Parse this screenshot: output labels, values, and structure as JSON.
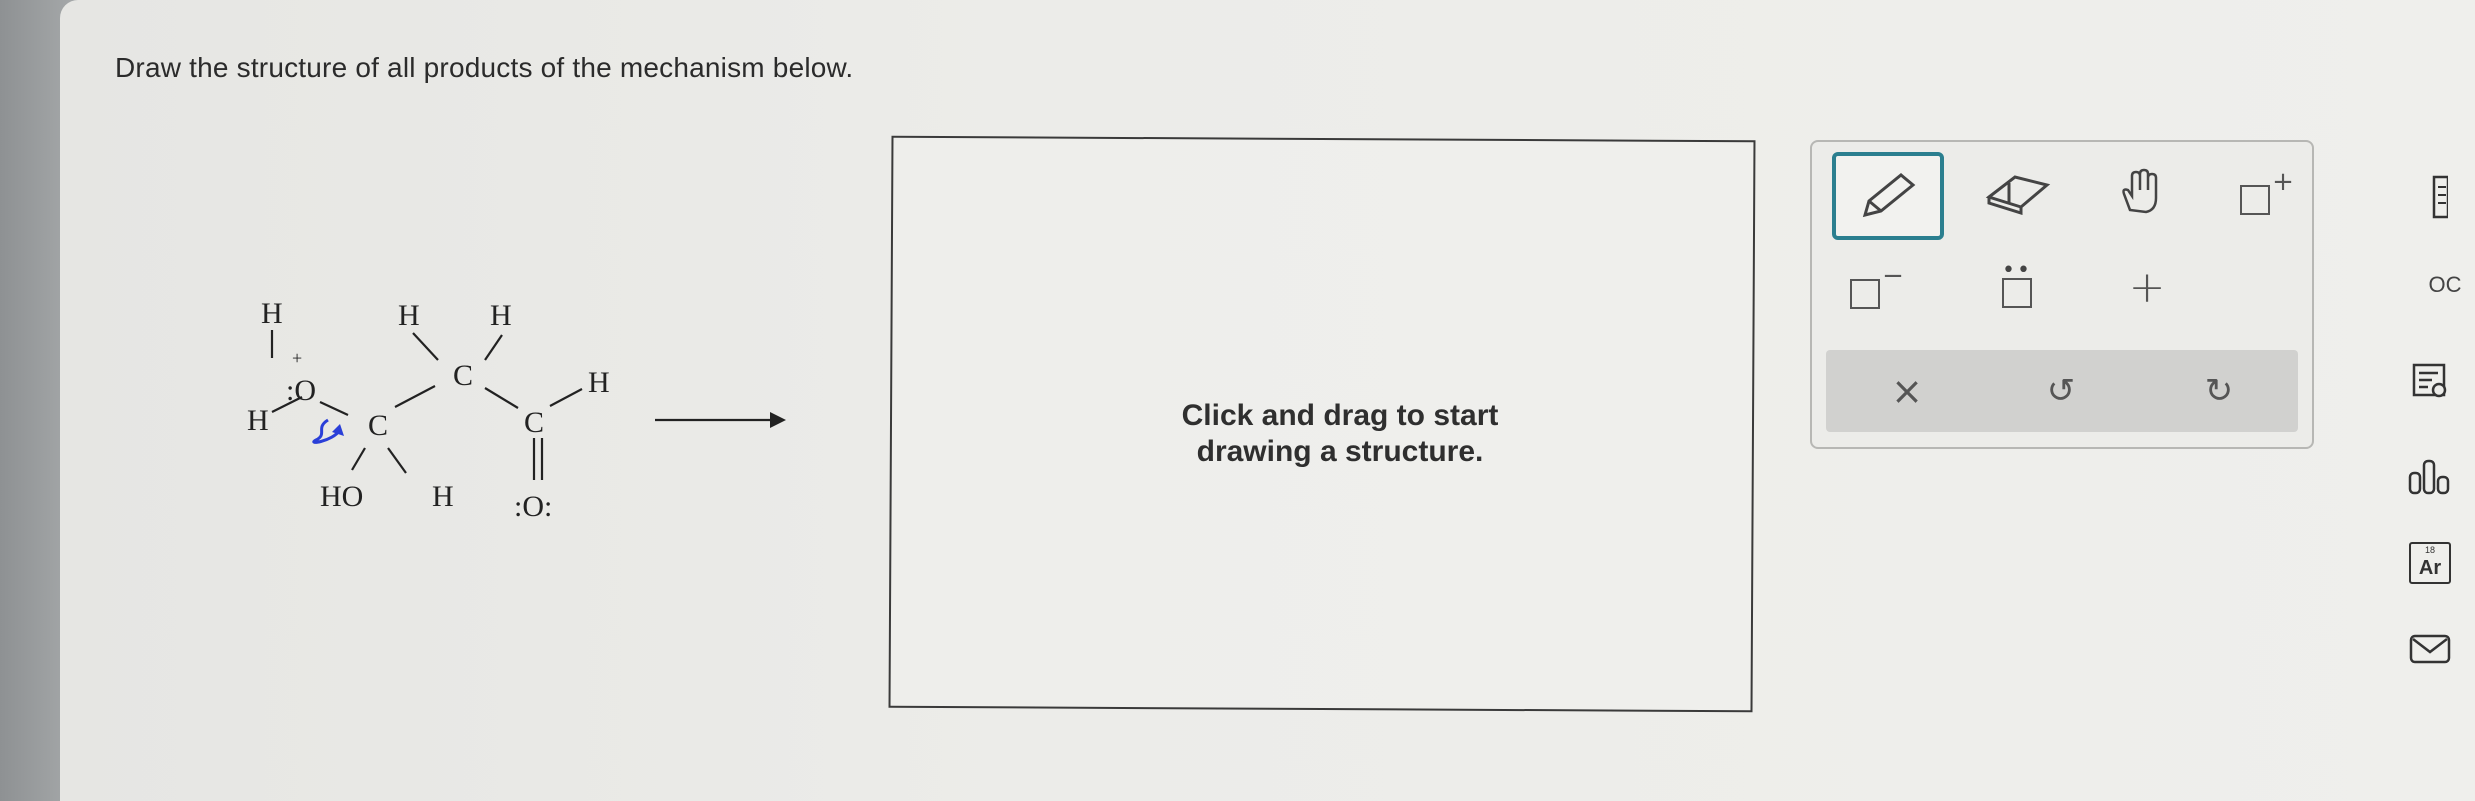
{
  "prompt": "Draw the structure of all products of the mechanism below.",
  "canvas": {
    "hint_line1": "Click and drag to start",
    "hint_line2": "drawing a structure."
  },
  "molecule": {
    "labels": {
      "h_top_oxygen": "H",
      "plus_charge": "+",
      "oxygen": ":O",
      "h_left": "H",
      "c_alpha": "C",
      "h_top1": "H",
      "h_top2": "H",
      "c_mid": "C",
      "c_carbonyl": "C",
      "h_aldehyde": "H",
      "ho_group": "HO",
      "h_bottom": "H",
      "carbonyl_oxygen": ":O:"
    }
  },
  "toolbar": {
    "pencil": "pencil-tool",
    "eraser": "eraser-tool",
    "hand": "hand-tool",
    "positive_charge": "+",
    "negative_charge": "−",
    "lone_pair_label": "••",
    "plus_icon": "+",
    "clear": "×",
    "undo": "↺",
    "redo": "↻"
  },
  "sidebar": {
    "periodic_table_label": "periodic-table",
    "more_label": "OC",
    "hint_label": "hint",
    "chart_label": "olo",
    "ar_label": "Ar",
    "ar_superscript": "18",
    "mail_label": "message"
  },
  "colors": {
    "accent": "#2b7f8f",
    "arrow_blue": "#2a3fd8",
    "text_dark": "#2b2b2b"
  }
}
